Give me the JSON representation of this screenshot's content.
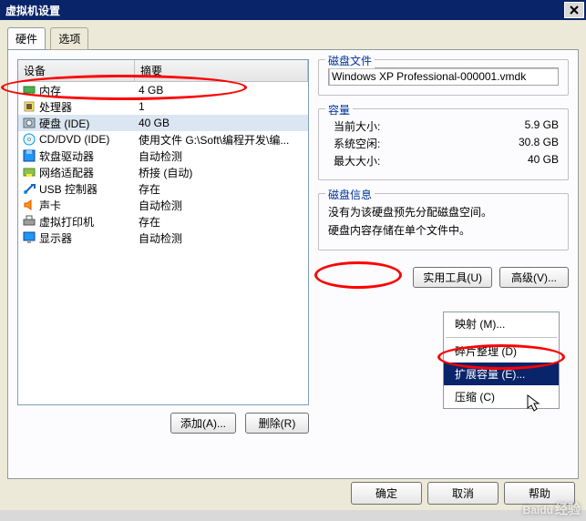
{
  "title": "虚拟机设置",
  "tabs": {
    "hardware": "硬件",
    "options": "选项"
  },
  "list_header": {
    "device": "设备",
    "summary": "摘要"
  },
  "devices": [
    {
      "icon": "memory",
      "name": "内存",
      "sum": "4 GB"
    },
    {
      "icon": "cpu",
      "name": "处理器",
      "sum": "1"
    },
    {
      "icon": "hdd",
      "name": "硬盘 (IDE)",
      "sum": "40 GB",
      "selected": true
    },
    {
      "icon": "cd",
      "name": "CD/DVD (IDE)",
      "sum": "使用文件 G:\\Soft\\编程开发\\编..."
    },
    {
      "icon": "floppy",
      "name": "软盘驱动器",
      "sum": "自动检测"
    },
    {
      "icon": "nic",
      "name": "网络适配器",
      "sum": "桥接 (自动)"
    },
    {
      "icon": "usb",
      "name": "USB 控制器",
      "sum": "存在"
    },
    {
      "icon": "sound",
      "name": "声卡",
      "sum": "自动检测"
    },
    {
      "icon": "printer",
      "name": "虚拟打印机",
      "sum": "存在"
    },
    {
      "icon": "display",
      "name": "显示器",
      "sum": "自动检测"
    }
  ],
  "left_buttons": {
    "add": "添加(A)...",
    "remove": "删除(R)"
  },
  "right": {
    "diskfile": {
      "legend": "磁盘文件",
      "value": "Windows XP Professional-000001.vmdk"
    },
    "capacity": {
      "legend": "容量",
      "rows": [
        {
          "k": "当前大小:",
          "v": "5.9 GB"
        },
        {
          "k": "系统空闲:",
          "v": "30.8 GB"
        },
        {
          "k": "最大大小:",
          "v": "40 GB"
        }
      ]
    },
    "diskinfo": {
      "legend": "磁盘信息",
      "line1": "没有为该硬盘预先分配磁盘空间。",
      "line2": "硬盘内容存储在单个文件中。"
    },
    "util_btn": "实用工具(U)",
    "adv_btn": "高级(V)...",
    "menu": {
      "map": "映射 (M)...",
      "defrag": "碎片整理 (D)",
      "expand": "扩展容量 (E)...",
      "compress": "压缩 (C)"
    }
  },
  "bottom": {
    "ok": "确定",
    "cancel": "取消",
    "help": "帮助"
  },
  "watermark": {
    "main": "Baidu",
    "sub": "经验"
  }
}
